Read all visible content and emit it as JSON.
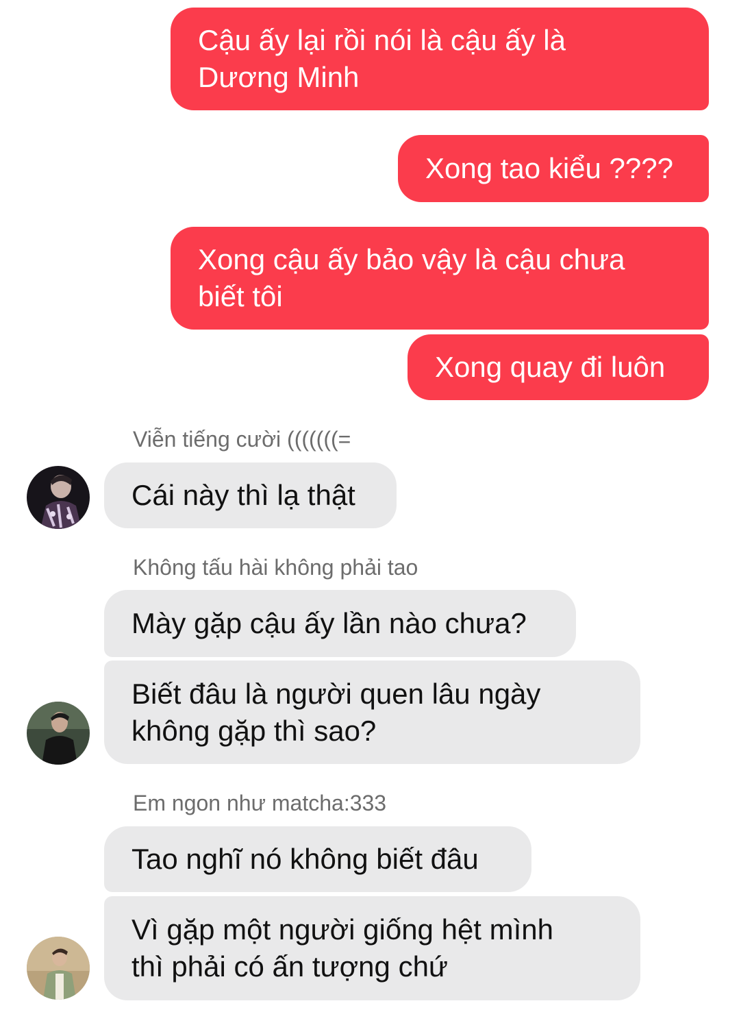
{
  "colors": {
    "outgoing_bubble": "#fb3c4c",
    "incoming_bubble": "#e9e9ea",
    "sender_name": "#6c6c6c"
  },
  "outgoing": [
    {
      "text": "Cậu ấy lại rồi nói là cậu ấy là\nDương Minh"
    },
    {
      "text": "Xong tao kiểu ????"
    },
    {
      "text": "Xong cậu ấy bảo vậy là cậu chưa\nbiết tôi"
    },
    {
      "text": "Xong quay đi luôn"
    }
  ],
  "groups": [
    {
      "sender": "Viễn tiếng cười (((((((=",
      "avatar": "avatar-icon",
      "messages": [
        "Cái này thì lạ thật"
      ]
    },
    {
      "sender": "Không tấu hài không phải tao",
      "avatar": "avatar-icon",
      "messages": [
        "Mày gặp cậu ấy lần nào chưa?",
        "Biết đâu là người quen lâu ngày\nkhông gặp thì sao?"
      ]
    },
    {
      "sender": "Em ngon như matcha:333",
      "avatar": "avatar-icon",
      "messages": [
        "Tao nghĩ nó không biết đâu",
        "Vì gặp một người giống hệt mình\nthì phải có ấn tượng chứ"
      ]
    }
  ]
}
